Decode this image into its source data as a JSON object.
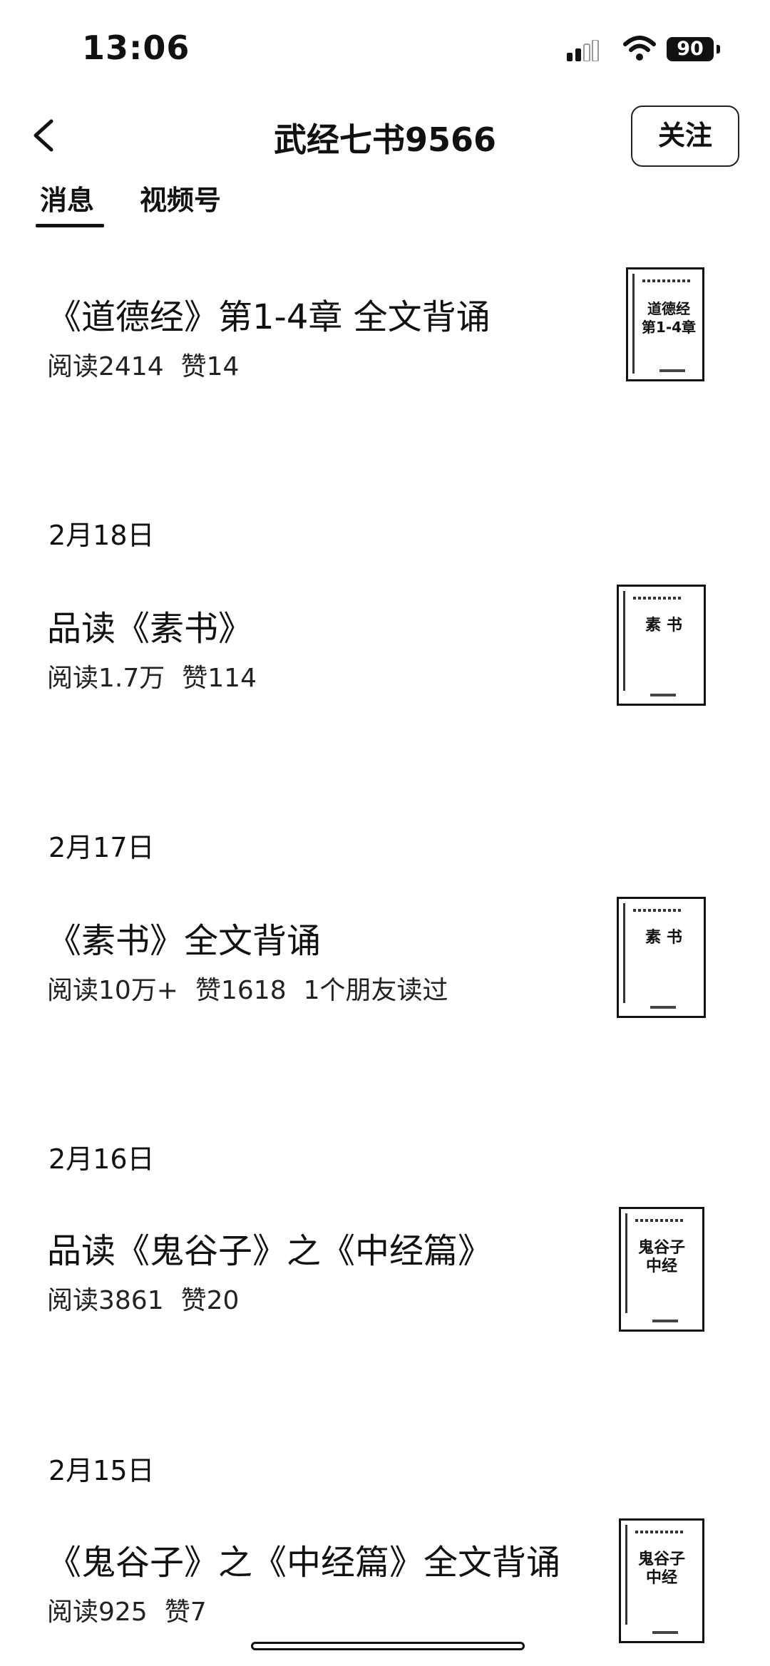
{
  "status_bar": {
    "time": "13:06",
    "battery": "90"
  },
  "nav": {
    "title": "武经七书9566",
    "follow_label": "关注"
  },
  "tabs": [
    {
      "label": "消息"
    },
    {
      "label": "视频号"
    }
  ],
  "articles": [
    {
      "date": "",
      "title": "《道德经》第1-4章 全文背诵",
      "reads": "阅读2414",
      "likes": "赞14",
      "extra": "",
      "thumb_text": "道德经\n第1-4章"
    },
    {
      "date": "2月18日",
      "title": "品读《素书》",
      "reads": "阅读1.7万",
      "likes": "赞114",
      "extra": "",
      "thumb_text": "素 书"
    },
    {
      "date": "2月17日",
      "title": "《素书》全文背诵",
      "reads": "阅读10万+",
      "likes": "赞1618",
      "extra": "1个朋友读过",
      "thumb_text": "素 书"
    },
    {
      "date": "2月16日",
      "title": "品读《鬼谷子》之《中经篇》",
      "reads": "阅读3861",
      "likes": "赞20",
      "extra": "",
      "thumb_text": "鬼谷子\n中经"
    },
    {
      "date": "2月15日",
      "title": "《鬼谷子》之《中经篇》全文背诵",
      "reads": "阅读925",
      "likes": "赞7",
      "extra": "",
      "thumb_text": "鬼谷子\n中经"
    }
  ]
}
